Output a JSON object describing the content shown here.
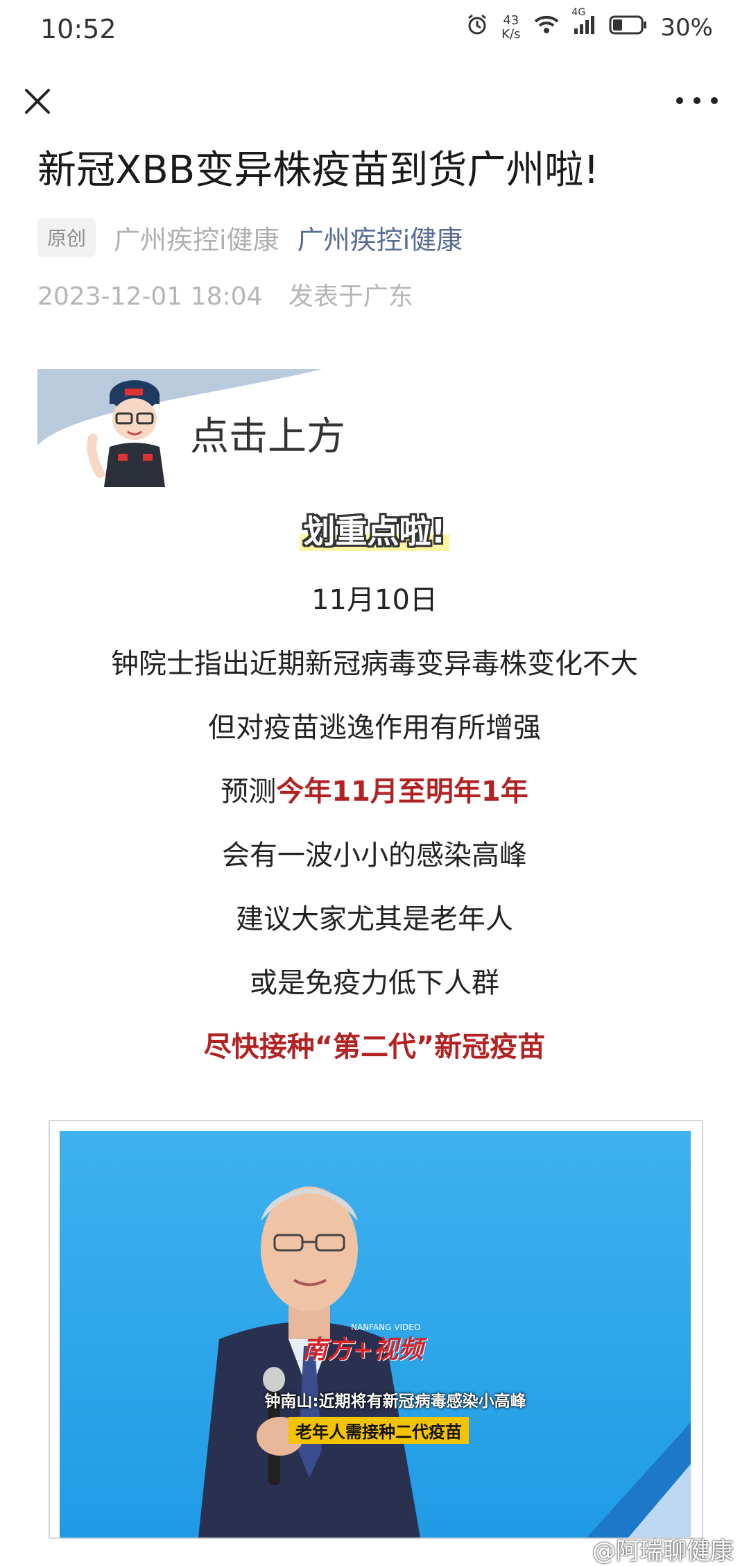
{
  "status": {
    "time": "10:52",
    "speed_value": "43",
    "speed_unit": "K/s",
    "network": "4G",
    "battery": "30%"
  },
  "article": {
    "title": "新冠XBB变异株疫苗到货广州啦!",
    "badge": "原创",
    "author": "广州疾控i健康",
    "account": "广州疾控i健康",
    "date": "2023-12-01 18:04",
    "location": "发表于广东"
  },
  "banner": {
    "text": "点击上方"
  },
  "body": {
    "highlight": "划重点啦!",
    "lines": [
      "11月10日",
      "钟院士指出近期新冠病毒变异毒株变化不大",
      "但对疫苗逃逸作用有所增强"
    ],
    "predict_prefix": "预测",
    "predict_red": "今年11月至明年1年",
    "lines2": [
      "会有一波小小的感染高峰",
      "建议大家尤其是老年人",
      "或是免疫力低下人群"
    ],
    "final_red": "尽快接种“第二代”新冠疫苗"
  },
  "photo": {
    "logo": "南方+视频",
    "logo_sub": "NANFANG VIDEO",
    "caption1": "钟南山:近期将有新冠病毒感染小高峰",
    "caption2": "老年人需接种二代疫苗"
  },
  "watermark": "@阿瑞聊健康"
}
